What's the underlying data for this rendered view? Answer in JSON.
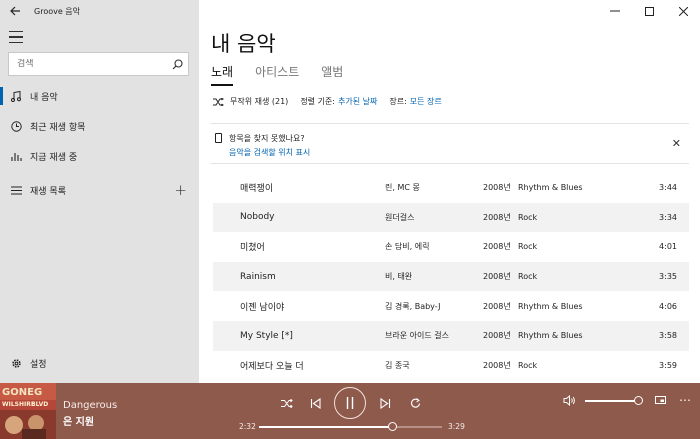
{
  "app": {
    "title": "Groove 음악"
  },
  "sidebar": {
    "search_placeholder": "검색",
    "items": [
      {
        "label": "내 음악",
        "icon": "music-note-icon",
        "active": true
      },
      {
        "label": "최근 재생 항목",
        "icon": "clock-icon",
        "active": false
      },
      {
        "label": "지금 재생 중",
        "icon": "equalizer-icon",
        "active": false
      }
    ],
    "playlists_label": "재생 목록",
    "settings_label": "설정"
  },
  "main": {
    "page_title": "내 음악",
    "tabs": [
      {
        "label": "노래",
        "active": true
      },
      {
        "label": "아티스트",
        "active": false
      },
      {
        "label": "앨범",
        "active": false
      }
    ],
    "filters": {
      "shuffle_label": "무작위 재생 (21)",
      "sort_label": "정렬 기준:",
      "sort_value": "추가된 날짜",
      "genre_label": "장르:",
      "genre_value": "모든 장르"
    },
    "notice": {
      "question": "항목을 찾지 못했나요?",
      "link": "음악을 검색할 위치 표시"
    },
    "songs": [
      {
        "title": "매력쟁이",
        "artist": "린, MC 몽",
        "year": "2008년",
        "genre": "Rhythm & Blues",
        "duration": "3:44"
      },
      {
        "title": "Nobody",
        "artist": "원더걸스",
        "year": "2008년",
        "genre": "Rock",
        "duration": "3:34"
      },
      {
        "title": "미쳤어",
        "artist": "손 담비, 에릭",
        "year": "2008년",
        "genre": "Rock",
        "duration": "4:01"
      },
      {
        "title": "Rainism",
        "artist": "비, 태완",
        "year": "2008년",
        "genre": "Rock",
        "duration": "3:35"
      },
      {
        "title": "이젠 남이야",
        "artist": "김 경록, Baby-J",
        "year": "2008년",
        "genre": "Rhythm & Blues",
        "duration": "4:06"
      },
      {
        "title": "My Style [*]",
        "artist": "브라운 아이드 걸스",
        "year": "2008년",
        "genre": "Rhythm & Blues",
        "duration": "3:58"
      },
      {
        "title": "어제보다 오늘 더",
        "artist": "김 종국",
        "year": "2008년",
        "genre": "Rock",
        "duration": "3:59"
      }
    ]
  },
  "player": {
    "title": "Dangerous",
    "artist": "은 지원",
    "elapsed": "2:32",
    "total": "3:29",
    "progress": 0.727,
    "volume": 1.0,
    "album_art_text": "GONE G CODE WILSHIRE BLVD"
  },
  "colors": {
    "accent": "#0063b1",
    "player_bg": "#8e5a4c",
    "sidebar_bg": "#e2e2e2"
  }
}
